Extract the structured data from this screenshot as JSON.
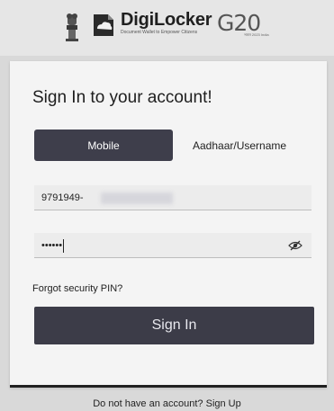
{
  "header": {
    "brand_name": "DigiLocker",
    "brand_tagline": "Document Wallet to Empower Citizens",
    "g20_text": "G20",
    "g20_subtext": "भारत 2023 India"
  },
  "card": {
    "title": "Sign In to your account!",
    "tabs": {
      "mobile": "Mobile",
      "aadhaar": "Aadhaar/Username"
    },
    "mobile_field": {
      "value": "9791949-"
    },
    "pin_field": {
      "value": "••••••"
    },
    "forgot_label": "Forgot security PIN?",
    "signin_label": "Sign In"
  },
  "footer": {
    "prompt": "Do not have an account?",
    "signup_label": "Sign Up"
  }
}
